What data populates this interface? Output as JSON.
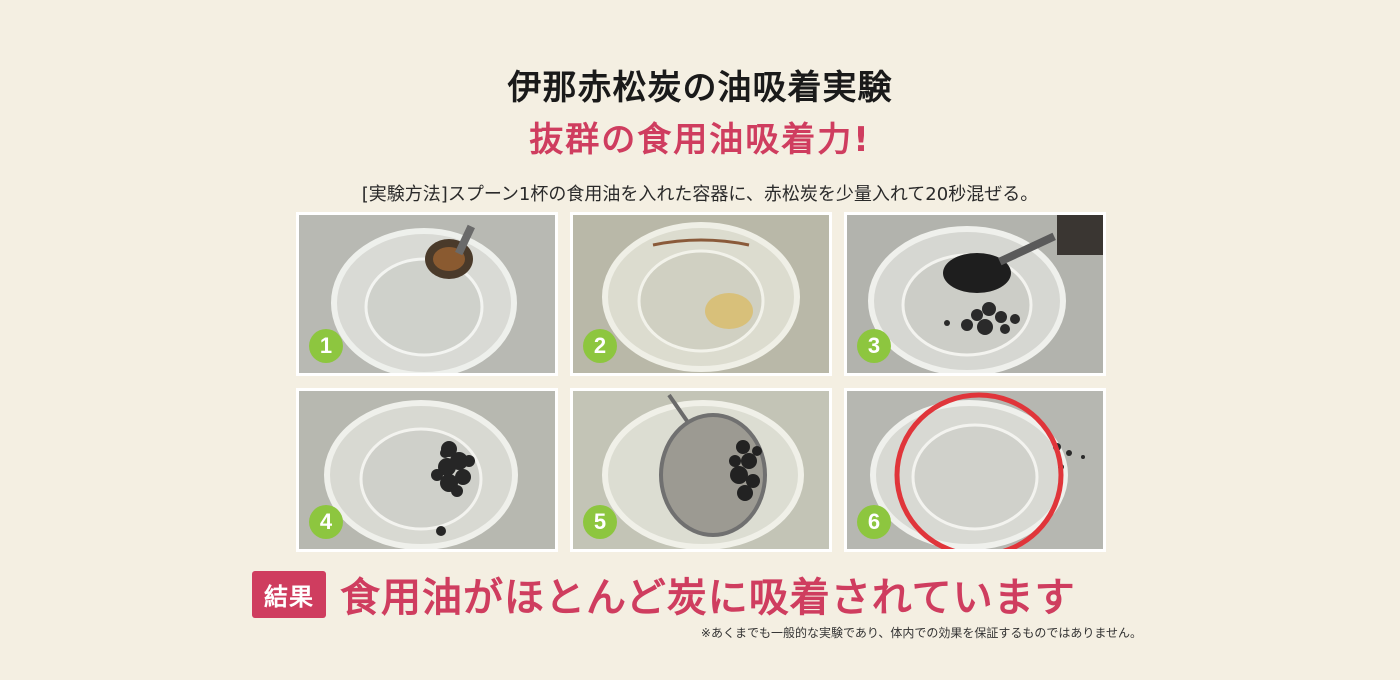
{
  "header": {
    "title": "伊那赤松炭の油吸着実験",
    "subtitle": "抜群の食用油吸着力!",
    "method": "[実験方法]スプーン1杯の食用油を入れた容器に、赤松炭を少量入れて20秒混ぜる。"
  },
  "steps": [
    {
      "number": "1"
    },
    {
      "number": "2"
    },
    {
      "number": "3"
    },
    {
      "number": "4"
    },
    {
      "number": "5"
    },
    {
      "number": "6"
    }
  ],
  "result": {
    "badge": "結果",
    "text": "食用油がほとんど炭に吸着されています",
    "disclaimer": "※あくまでも一般的な実験であり、体内での効果を保証するものではありません。"
  },
  "colors": {
    "background": "#f4efe2",
    "accent": "#cf3d5f",
    "step_badge": "#8dc63f",
    "highlight_ring": "#e0353a"
  }
}
